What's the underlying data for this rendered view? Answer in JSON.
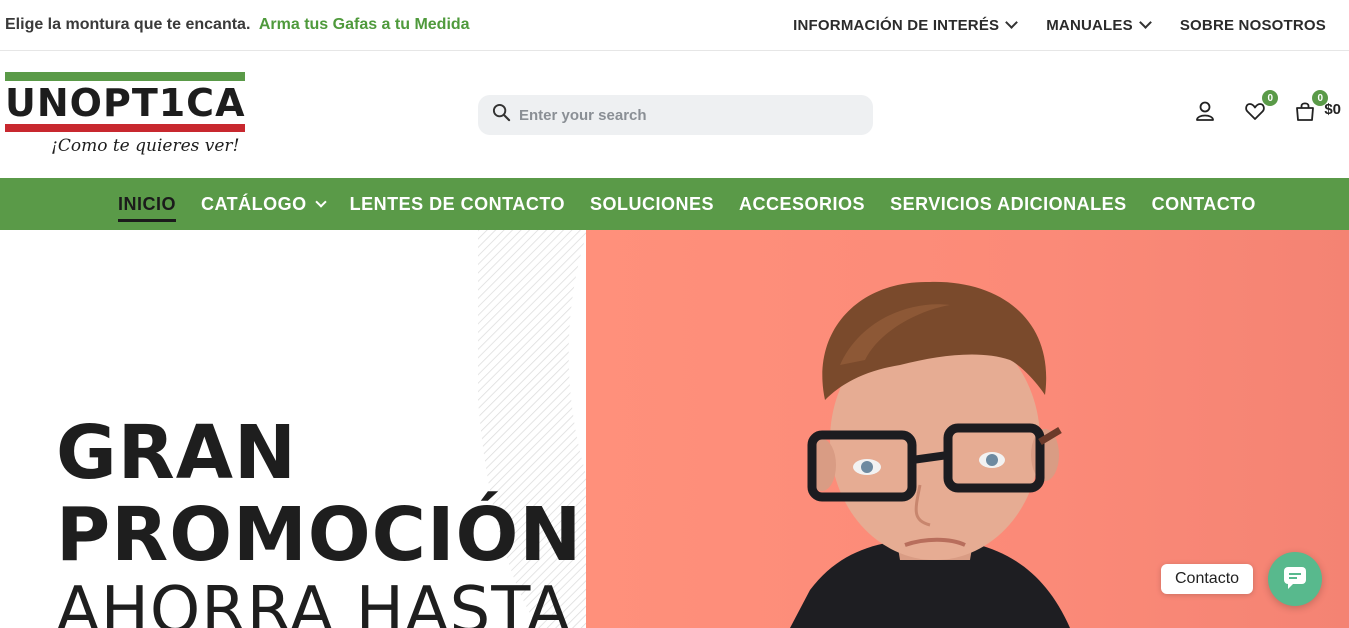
{
  "topbar": {
    "promo_text": "Elige la montura que te encanta.",
    "promo_link": "Arma tus Gafas a tu Medida",
    "links": [
      {
        "label": "INFORMACIÓN DE INTERÉS"
      },
      {
        "label": "MANUALES"
      },
      {
        "label": "SOBRE NOSOTROS"
      }
    ]
  },
  "header": {
    "logo_text": "UNOPT1CA",
    "logo_tagline": "¡Como te quieres ver!",
    "search_placeholder": "Enter your search",
    "wishlist_count": "0",
    "cart_count": "0",
    "cart_total": "$0"
  },
  "mainnav": {
    "items": [
      {
        "label": "INICIO"
      },
      {
        "label": "CATÁLOGO"
      },
      {
        "label": "LENTES DE CONTACTO"
      },
      {
        "label": "SOLUCIONES"
      },
      {
        "label": "ACCESORIOS"
      },
      {
        "label": "SERVICIOS ADICIONALES"
      },
      {
        "label": "CONTACTO"
      }
    ]
  },
  "hero": {
    "line1": "GRAN",
    "line2": "PROMOCIÓN",
    "line3": "AHORRA HASTA"
  },
  "contact_widget": {
    "label": "Contacto"
  },
  "colors": {
    "brand_green": "#5a9a48",
    "brand_red": "#c8282f",
    "hero_salmon": "#fb8a78",
    "chat_green": "#58b98d"
  }
}
